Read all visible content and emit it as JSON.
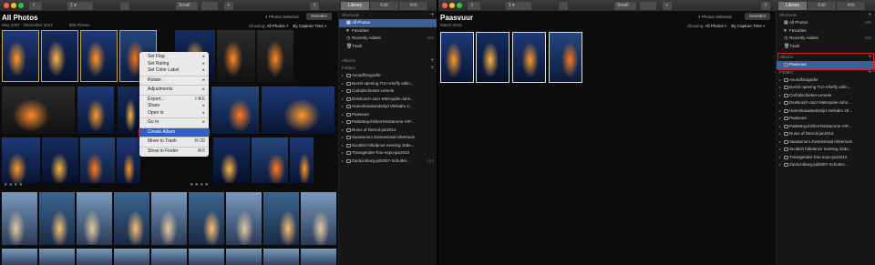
{
  "left": {
    "toolbar": {
      "tabs": [
        "Library",
        "Edit",
        "Info"
      ],
      "zoom": "Small"
    },
    "title": "All Photos",
    "date_range": "May 2007 - December 2017",
    "count": "585 Photos",
    "selected_info": "4 Photos Selected",
    "deselect": "Deselect",
    "showing_label": "Showing:",
    "showing_value": "All Photos",
    "sort": "By Capture Time",
    "context_menu": [
      {
        "label": "Set Flag",
        "shortcut": "▸"
      },
      {
        "label": "Set Rating",
        "shortcut": "▸"
      },
      {
        "label": "Set Color Label",
        "shortcut": "▸"
      },
      {
        "sep": true
      },
      {
        "label": "Rotate",
        "shortcut": "▸"
      },
      {
        "sep": true
      },
      {
        "label": "Adjustments",
        "shortcut": "▸"
      },
      {
        "sep": true
      },
      {
        "label": "Export...",
        "shortcut": "⇧⌘E"
      },
      {
        "label": "Share",
        "shortcut": "▸"
      },
      {
        "label": "Open in",
        "shortcut": "▸"
      },
      {
        "sep": true
      },
      {
        "label": "Go to",
        "shortcut": "▸"
      },
      {
        "sep": true
      },
      {
        "label": "Create Album",
        "shortcut": "",
        "highlight": true
      },
      {
        "sep": true
      },
      {
        "label": "Move to Trash",
        "shortcut": "⌘⌫"
      },
      {
        "sep": true
      },
      {
        "label": "Show in Finder",
        "shortcut": "⌘R"
      }
    ],
    "sidebar": {
      "shortcuts_title": "Shortcuts",
      "shortcuts": [
        {
          "label": "All Photos",
          "count": "585",
          "icon": "photos-icon",
          "selected": true
        },
        {
          "label": "Favorites",
          "count": "",
          "icon": "heart-icon"
        },
        {
          "label": "Recently Added",
          "count": "585",
          "icon": "clock-icon"
        },
        {
          "label": "Trash",
          "count": "",
          "icon": "trash-icon"
        }
      ],
      "albums_title": "Albums",
      "folders_title": "Folders",
      "folders": [
        {
          "label": "Avondfotografie",
          "count": ""
        },
        {
          "label": "Borrel opening TUI-Arkefly airlin...",
          "count": ""
        },
        {
          "label": "Carbidschieten-Lemele",
          "count": ""
        },
        {
          "label": "DenBosch-Jazz-Metropole-John...",
          "count": ""
        },
        {
          "label": "Hanenkraaiwedstrijd Vlelsalm 2...",
          "count": ""
        },
        {
          "label": "Paasvuur",
          "count": ""
        },
        {
          "label": "PattieBoyd-EllenTenDamme-VIP...",
          "count": ""
        },
        {
          "label": "Ruins of Detroit-jan2012",
          "count": ""
        },
        {
          "label": "Sanatorium Zonnestraal Hilversum",
          "count": ""
        },
        {
          "label": "Scottish folkdance evening 15de...",
          "count": ""
        },
        {
          "label": "Transgender-foto-expo-jan2010",
          "count": ""
        },
        {
          "label": "ZuidLimburg-juli2007-Schutter...",
          "count": "144"
        }
      ]
    }
  },
  "right": {
    "toolbar": {
      "tabs": [
        "Library",
        "Edit",
        "Info"
      ],
      "zoom": "Small"
    },
    "title": "Paasvuur",
    "date_range": "March 2016",
    "count": "4 Photos",
    "selected_info": "4 Photos Selected",
    "deselect": "Deselect",
    "showing_label": "Showing:",
    "showing_value": "All Photos",
    "sort": "By Capture Time",
    "sidebar": {
      "shortcuts_title": "Shortcuts",
      "shortcuts": [
        {
          "label": "All Photos",
          "count": "585",
          "icon": "photos-icon"
        },
        {
          "label": "Favorites",
          "count": "",
          "icon": "heart-icon"
        },
        {
          "label": "Recently Added",
          "count": "585",
          "icon": "clock-icon"
        },
        {
          "label": "Trash",
          "count": "",
          "icon": "trash-icon"
        }
      ],
      "albums_title": "Albums",
      "albums": [
        {
          "label": "Paasvuur",
          "selected": true
        }
      ],
      "folders_title": "Folders",
      "folders": [
        {
          "label": "Avondfotografie"
        },
        {
          "label": "Borrel opening TUI-Arkefly airlin..."
        },
        {
          "label": "Carbidschieten-Lemele"
        },
        {
          "label": "DenBosch-Jazz-Metropole-John..."
        },
        {
          "label": "Hanenkraaiwedstrijd Vielsalm 20..."
        },
        {
          "label": "Paasvuur"
        },
        {
          "label": "PattieBoyd-EllenTenDamme-VIP..."
        },
        {
          "label": "Ruins of Detroit-jan2012"
        },
        {
          "label": "Sanatorium Zonnestraal Hilversum"
        },
        {
          "label": "Scottish folkdance evening 15de..."
        },
        {
          "label": "Transgender-foto-expo-jan2010"
        },
        {
          "label": "ZuidLimburg-juli2007-Schutter..."
        }
      ]
    }
  },
  "colors": {
    "accent": "#3a5f9b",
    "highlight": "#d81e2c",
    "selection": "#c5a44e"
  }
}
